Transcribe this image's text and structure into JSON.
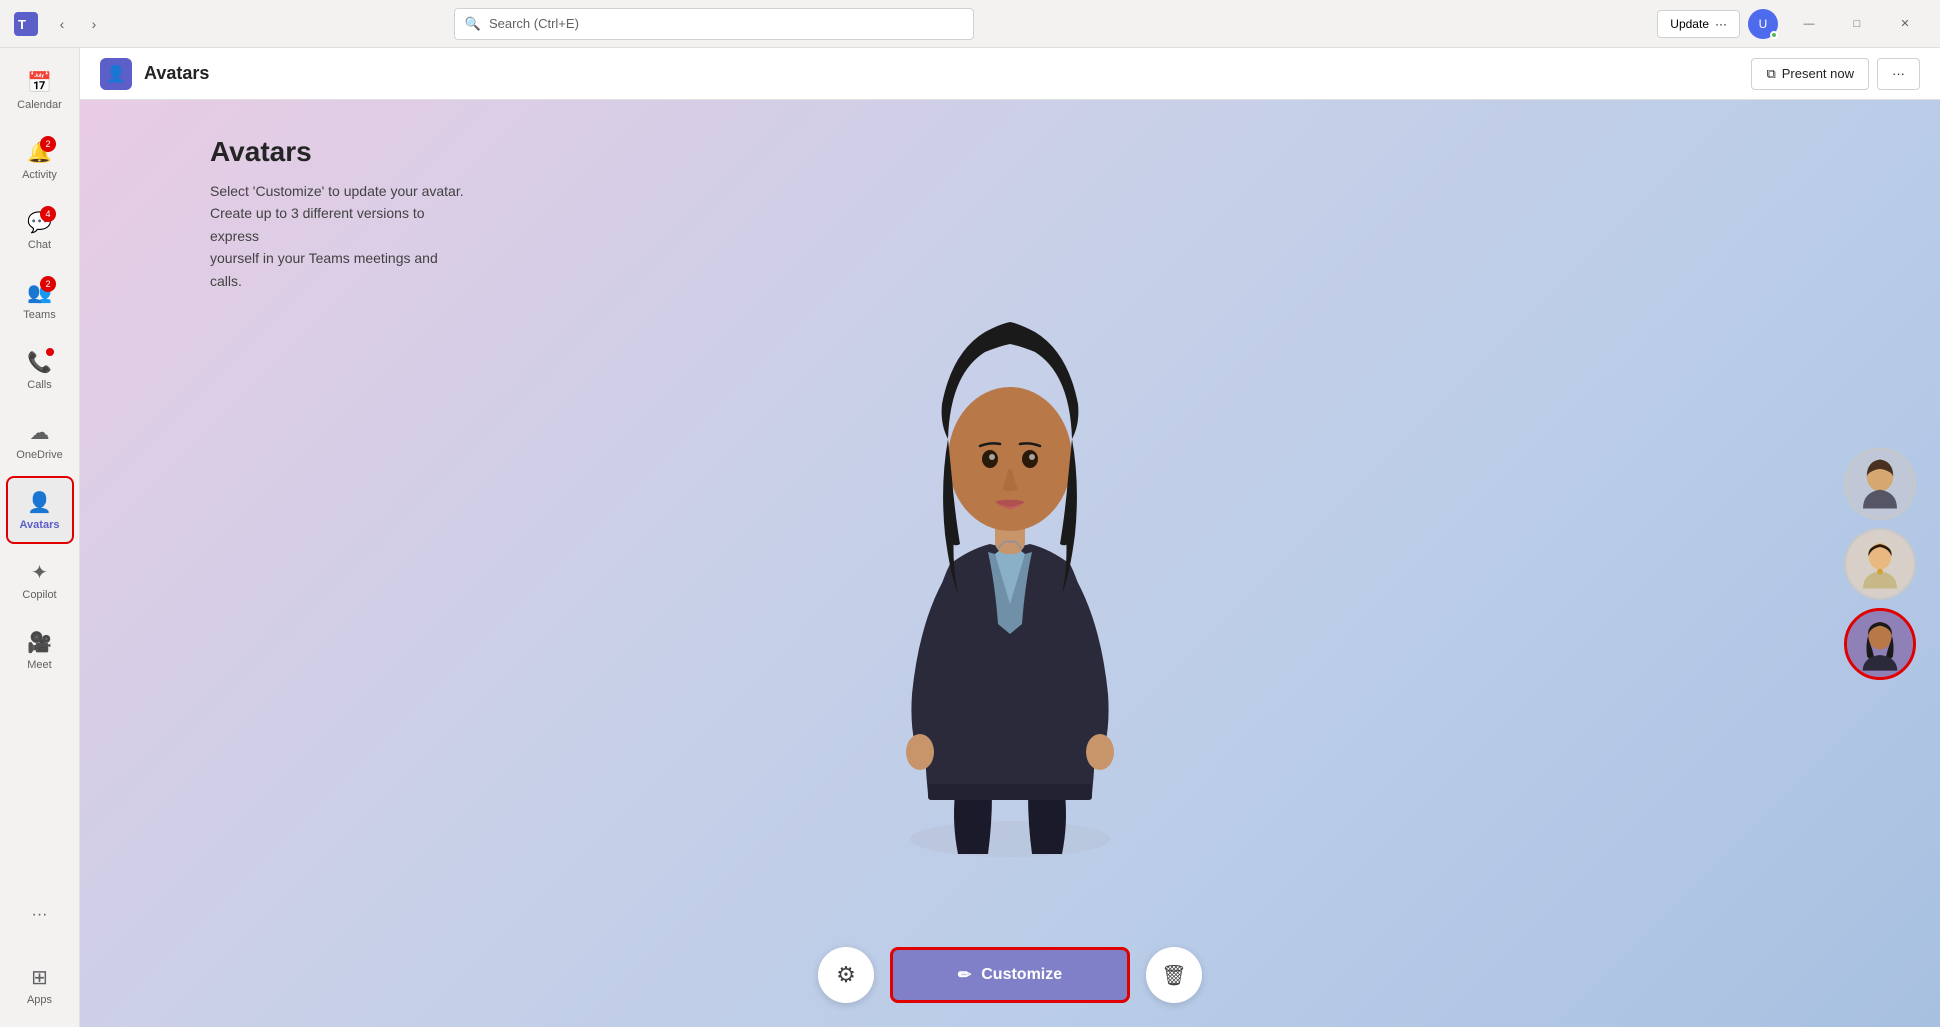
{
  "titlebar": {
    "search_placeholder": "Search (Ctrl+E)",
    "update_label": "Update",
    "update_dots": "···",
    "minimize_label": "—",
    "maximize_label": "□",
    "close_label": "✕"
  },
  "sidebar": {
    "items": [
      {
        "id": "calendar",
        "label": "Calendar",
        "icon": "📅",
        "badge": null
      },
      {
        "id": "activity",
        "label": "Activity",
        "icon": "🔔",
        "badge": "2"
      },
      {
        "id": "chat",
        "label": "Chat",
        "icon": "💬",
        "badge": "4"
      },
      {
        "id": "teams",
        "label": "Teams",
        "icon": "👥",
        "badge": "2"
      },
      {
        "id": "calls",
        "label": "Calls",
        "icon": "📞",
        "badge_dot": true
      },
      {
        "id": "onedrive",
        "label": "OneDrive",
        "icon": "☁",
        "badge": null
      },
      {
        "id": "avatars",
        "label": "Avatars",
        "icon": "👤",
        "badge": null,
        "active": true
      },
      {
        "id": "copilot",
        "label": "Copilot",
        "icon": "✦",
        "badge": null
      },
      {
        "id": "meet",
        "label": "Meet",
        "icon": "🎥",
        "badge": null
      }
    ],
    "more_label": "···",
    "apps_label": "Apps"
  },
  "header": {
    "app_icon": "👤",
    "title": "Avatars",
    "present_now": "Present now",
    "more_dots": "···"
  },
  "main": {
    "title": "Avatars",
    "description_line1": "Select 'Customize' to update your avatar.",
    "description_line2": "Create up to 3 different versions to express",
    "description_line3": "yourself in your Teams meetings and calls.",
    "customize_label": "Customize"
  },
  "colors": {
    "accent": "#5b5fc7",
    "active_border": "#e00000",
    "customize_bg": "#8080c8",
    "badge_bg": "#cc0000"
  }
}
